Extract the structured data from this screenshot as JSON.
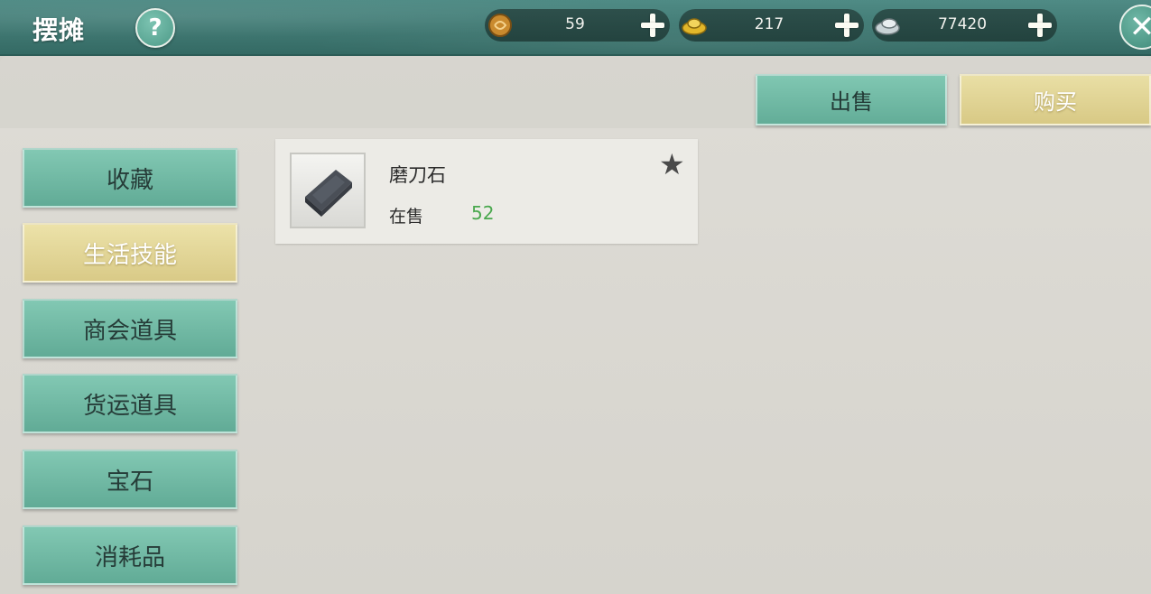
{
  "header": {
    "title": "摆摊",
    "help_label": "?",
    "close_label": "✕"
  },
  "currencies": [
    {
      "name": "coin-icon",
      "value": "59",
      "color": "#c98a2e"
    },
    {
      "name": "gold-ingot-icon",
      "value": "217",
      "color": "#e2b72a"
    },
    {
      "name": "silver-icon",
      "value": "77420",
      "color": "#c9d3d6"
    }
  ],
  "actions": {
    "sell_label": "出售",
    "buy_label": "购买"
  },
  "sidebar": {
    "items": [
      {
        "label": "收藏",
        "active": false
      },
      {
        "label": "生活技能",
        "active": true
      },
      {
        "label": "商会道具",
        "active": false
      },
      {
        "label": "货运道具",
        "active": false
      },
      {
        "label": "宝石",
        "active": false
      },
      {
        "label": "消耗品",
        "active": false
      }
    ]
  },
  "items": [
    {
      "name": "磨刀石",
      "status_label": "在售",
      "count": "52",
      "favorite": true,
      "icon": "whetstone-icon"
    }
  ]
}
